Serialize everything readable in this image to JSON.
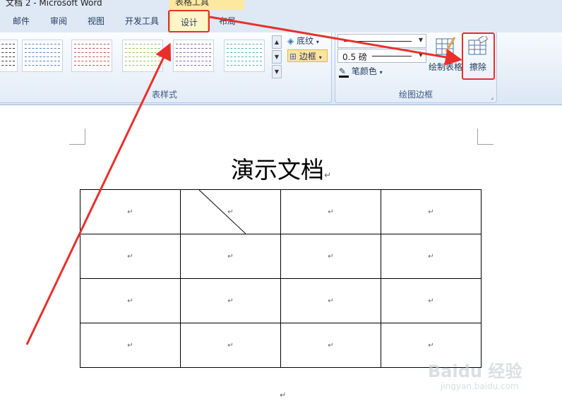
{
  "window": {
    "title": "文档 2 - Microsoft Word",
    "context_group": "表格工具"
  },
  "tabs": {
    "mail": "邮件",
    "review": "审阅",
    "view": "视图",
    "developer": "开发工具",
    "design": "设计",
    "layout": "布局"
  },
  "ribbon": {
    "table_styles": {
      "label": "表样式",
      "shading_label": "底纹",
      "borders_label": "边框",
      "thumbnail_colors": [
        "#333333",
        "#4f81bd",
        "#c0504d",
        "#9bbb59",
        "#8064a2",
        "#4bacc6"
      ]
    },
    "draw_borders": {
      "label": "绘图边框",
      "line_weight": "0.5 磅",
      "pen_color_label": "笔颜色",
      "draw_table_label": "绘制表格",
      "eraser_label": "擦除"
    }
  },
  "document": {
    "title": "演示文档",
    "para_mark": "↵",
    "table": {
      "rows": 4,
      "cols": 4,
      "cell_text": "↵",
      "diagonal_cell": [
        0,
        1
      ]
    }
  },
  "watermark": {
    "brand": "Baidu 经验",
    "url": "jingyan.baidu.com"
  },
  "annotation": {
    "color": "#e8302b"
  }
}
